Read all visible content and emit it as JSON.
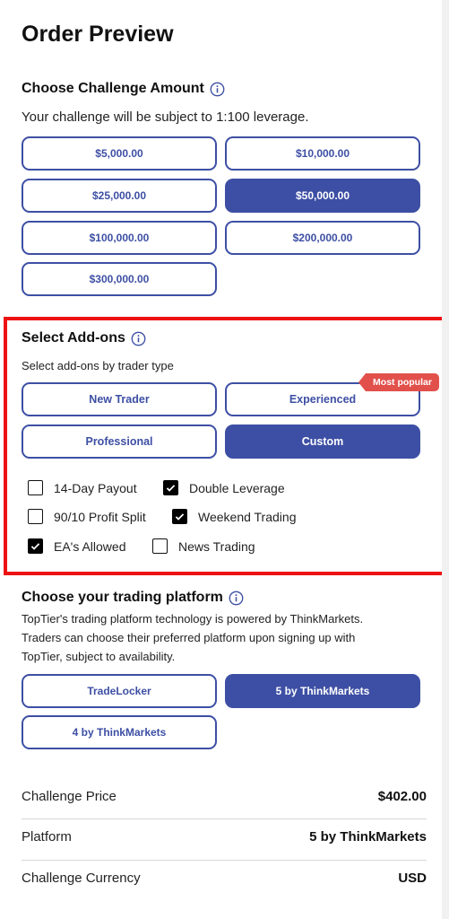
{
  "page": {
    "title": "Order Preview"
  },
  "challenge": {
    "heading": "Choose Challenge Amount",
    "subtitle": "Your challenge will be subject to 1:100 leverage.",
    "amounts": [
      "$5,000.00",
      "$10,000.00",
      "$25,000.00",
      "$50,000.00",
      "$100,000.00",
      "$200,000.00",
      "$300,000.00"
    ],
    "selected": "$50,000.00"
  },
  "addons": {
    "heading": "Select Add-ons",
    "subtitle": "Select add-ons by trader type",
    "badge": "Most popular",
    "trader_types": [
      "New Trader",
      "Experienced",
      "Professional",
      "Custom"
    ],
    "selected_type": "Custom",
    "options": [
      {
        "label": "14-Day Payout",
        "checked": false
      },
      {
        "label": "Double Leverage",
        "checked": true
      },
      {
        "label": "90/10 Profit Split",
        "checked": false
      },
      {
        "label": "Weekend Trading",
        "checked": true
      },
      {
        "label": "EA's Allowed",
        "checked": true
      },
      {
        "label": "News Trading",
        "checked": false
      }
    ]
  },
  "platform": {
    "heading": "Choose your trading platform",
    "description": [
      "TopTier's trading platform technology is powered by ThinkMarkets.",
      "Traders can choose their preferred platform upon signing up with",
      "TopTier, subject to availability."
    ],
    "options": [
      "TradeLocker",
      "5 by ThinkMarkets",
      "4 by ThinkMarkets"
    ],
    "selected": "5 by ThinkMarkets"
  },
  "summary": [
    {
      "label": "Challenge Price",
      "value": "$402.00"
    },
    {
      "label": "Platform",
      "value": "5 by ThinkMarkets"
    },
    {
      "label": "Challenge Currency",
      "value": "USD"
    }
  ],
  "colors": {
    "accent": "#3d4fa4",
    "highlight": "#ee1111",
    "badge": "#e2504b"
  }
}
